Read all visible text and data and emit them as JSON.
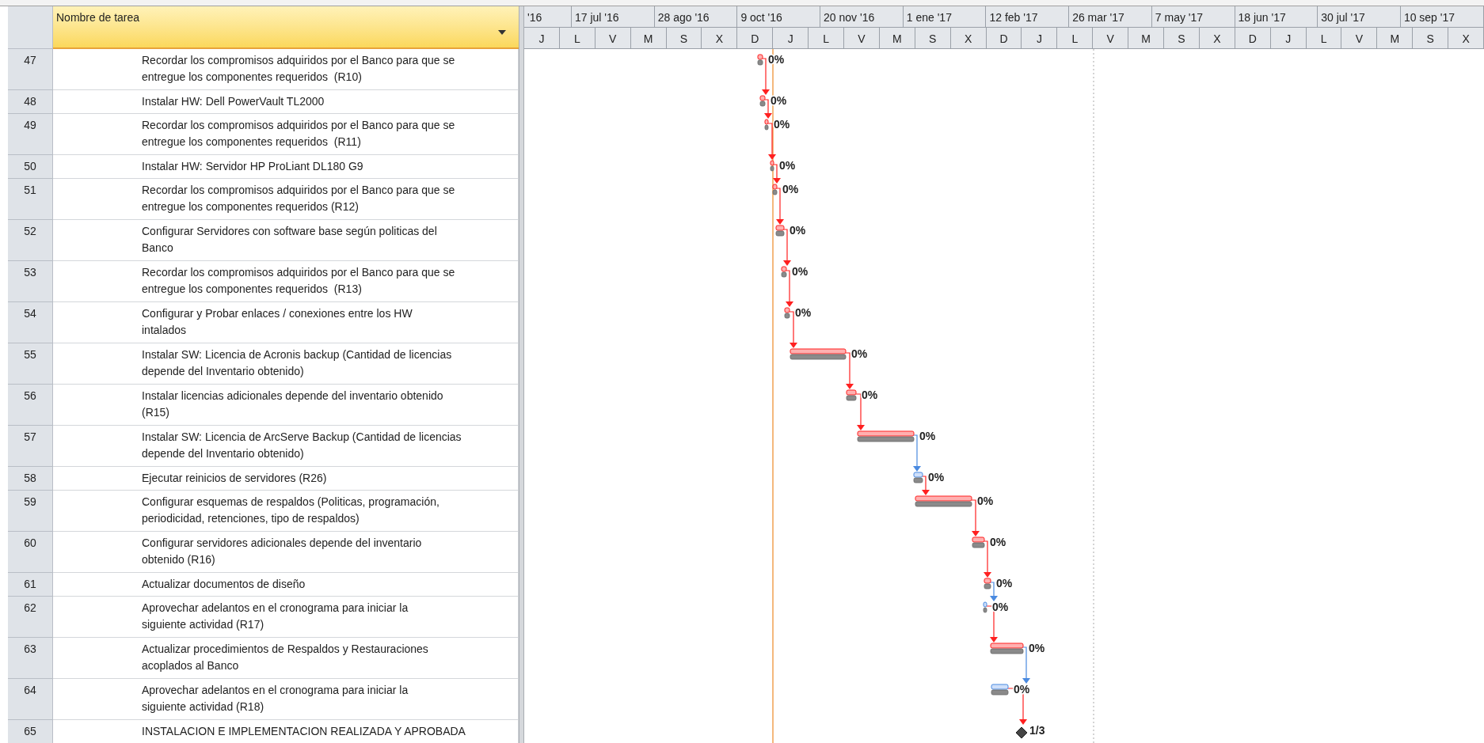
{
  "table": {
    "columns": [
      "Nombre de tarea"
    ],
    "rows": [
      {
        "id": "47",
        "name": [
          "Recordar los compromisos adquiridos por el Banco para que se",
          "entregue los componentes requeridos  (R10)"
        ],
        "bar": {
          "kind": "task",
          "critical": true,
          "progress": "0%"
        }
      },
      {
        "id": "48",
        "name": [
          "Instalar HW: Dell PowerVault TL2000"
        ],
        "bar": {
          "kind": "task",
          "critical": true,
          "progress": "0%"
        }
      },
      {
        "id": "49",
        "name": [
          "Recordar los compromisos adquiridos por el Banco para que se",
          "entregue los componentes requeridos  (R11)"
        ],
        "bar": {
          "kind": "task",
          "critical": true,
          "progress": "0%"
        }
      },
      {
        "id": "50",
        "name": [
          "Instalar HW: Servidor HP ProLiant DL180 G9"
        ],
        "bar": {
          "kind": "task",
          "critical": true,
          "progress": "0%"
        }
      },
      {
        "id": "51",
        "name": [
          "Recordar los compromisos adquiridos por el Banco para que se",
          "entregue los componentes requeridos (R12)"
        ],
        "bar": {
          "kind": "task",
          "critical": true,
          "progress": "0%"
        }
      },
      {
        "id": "52",
        "name": [
          "Configurar Servidores con software base según politicas del",
          "Banco"
        ],
        "bar": {
          "kind": "task",
          "critical": true,
          "progress": "0%"
        }
      },
      {
        "id": "53",
        "name": [
          "Recordar los compromisos adquiridos por el Banco para que se",
          "entregue los componentes requeridos  (R13)"
        ],
        "bar": {
          "kind": "task",
          "critical": true,
          "progress": "0%"
        }
      },
      {
        "id": "54",
        "name": [
          "Configurar y Probar enlaces / conexiones entre los HW",
          "intalados"
        ],
        "bar": {
          "kind": "task",
          "critical": true,
          "progress": "0%"
        }
      },
      {
        "id": "55",
        "name": [
          "Instalar SW: Licencia de Acronis backup (Cantidad de licencias",
          "depende del Inventario obtenido)"
        ],
        "bar": {
          "kind": "task",
          "critical": true,
          "progress": "0%"
        }
      },
      {
        "id": "56",
        "name": [
          "Instalar licencias adicionales depende del inventario obtenido",
          "(R15)"
        ],
        "bar": {
          "kind": "task",
          "critical": true,
          "progress": "0%"
        }
      },
      {
        "id": "57",
        "name": [
          "Instalar SW: Licencia de ArcServe Backup (Cantidad de licencias",
          "depende del Inventario obtenido)"
        ],
        "bar": {
          "kind": "task",
          "critical": true,
          "progress": "0%"
        }
      },
      {
        "id": "58",
        "name": [
          "Ejecutar reinicios de servidores (R26)"
        ],
        "bar": {
          "kind": "task",
          "critical": false,
          "progress": "0%"
        }
      },
      {
        "id": "59",
        "name": [
          "Configurar esquemas de respaldos (Politicas, programación,",
          "periodicidad, retenciones, tipo de respaldos)"
        ],
        "bar": {
          "kind": "task",
          "critical": true,
          "progress": "0%"
        }
      },
      {
        "id": "60",
        "name": [
          "Configurar servidores adicionales depende del inventario",
          "obtenido (R16)"
        ],
        "bar": {
          "kind": "task",
          "critical": true,
          "progress": "0%"
        }
      },
      {
        "id": "61",
        "name": [
          "Actualizar documentos de diseño"
        ],
        "bar": {
          "kind": "task",
          "critical": true,
          "progress": "0%"
        }
      },
      {
        "id": "62",
        "name": [
          "Aprovechar adelantos en el cronograma para iniciar la",
          "siguiente actividad (R17)"
        ],
        "bar": {
          "kind": "task",
          "critical": false,
          "progress": "0%"
        }
      },
      {
        "id": "63",
        "name": [
          "Actualizar procedimientos de Respaldos y Restauraciones",
          "acoplados al Banco"
        ],
        "bar": {
          "kind": "task",
          "critical": true,
          "progress": "0%"
        }
      },
      {
        "id": "64",
        "name": [
          "Aprovechar adelantos en el cronograma para iniciar la",
          "siguiente actividad (R18)"
        ],
        "bar": {
          "kind": "task",
          "critical": false,
          "progress": "0%"
        }
      },
      {
        "id": "65",
        "name": [
          "INSTALACION E IMPLEMENTACION REALIZADA Y APROBADA"
        ],
        "bar": {
          "kind": "milestone",
          "progress": "1/3"
        }
      }
    ]
  },
  "timeline": {
    "major": [
      "'16",
      "17 jul '16",
      "28 ago '16",
      "9 oct '16",
      "20 nov '16",
      "1 ene '17",
      "12 feb '17",
      "26 mar '17",
      "7 may '17",
      "18 jun '17",
      "30 jul '17",
      "10 sep '17"
    ],
    "minor": [
      "J",
      "L",
      "V",
      "M",
      "S",
      "X",
      "D",
      "J",
      "L",
      "V",
      "M",
      "S",
      "X",
      "D",
      "J",
      "L",
      "V",
      "M",
      "S",
      "X",
      "D",
      "J",
      "L",
      "V",
      "M",
      "S",
      "X"
    ]
  }
}
